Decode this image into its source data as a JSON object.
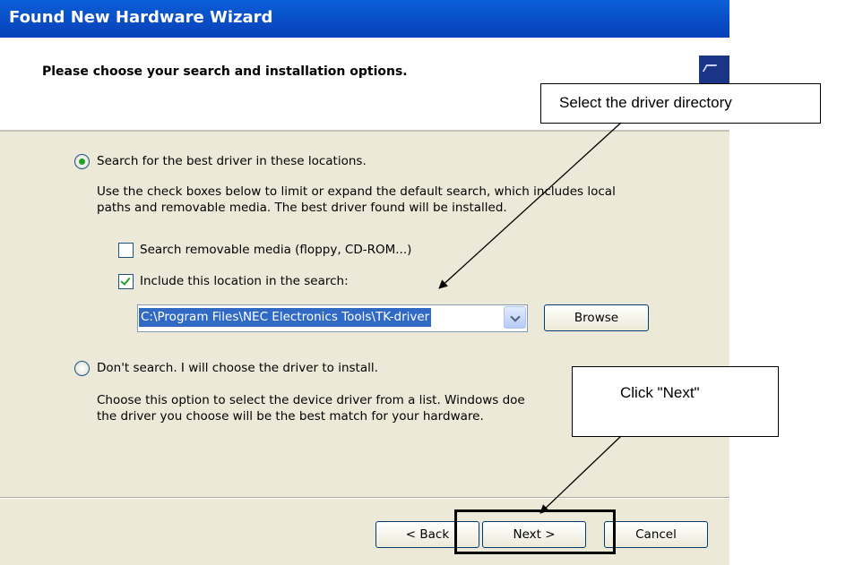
{
  "window": {
    "title": "Found New Hardware Wizard"
  },
  "header": {
    "title": "Please choose your search and installation options."
  },
  "options": {
    "search": {
      "label": "Search for the best driver in these locations.",
      "selected": true,
      "description_line1": "Use the check boxes below to limit or expand the default search, which includes local",
      "description_line2": "paths and removable media. The best driver found will be installed.",
      "removable_media": {
        "label": "Search removable media (floppy, CD-ROM...)",
        "checked": false
      },
      "include_location": {
        "label": "Include this location in the search:",
        "checked": true
      },
      "location_value": "C:\\Program Files\\NEC Electronics Tools\\TK-driver",
      "browse_label": "Browse"
    },
    "dont_search": {
      "label": "Don't search. I will choose the driver to install.",
      "selected": false,
      "description_line1": "Choose this option to select the device driver from a list.  Windows doe",
      "description_line2": "the driver you choose will be the best match for your hardware."
    }
  },
  "buttons": {
    "back": "< Back",
    "next": "Next >",
    "cancel": "Cancel"
  },
  "annotations": {
    "callout_driver_dir": "Select the driver directory",
    "callout_next": "Click \"Next\""
  }
}
